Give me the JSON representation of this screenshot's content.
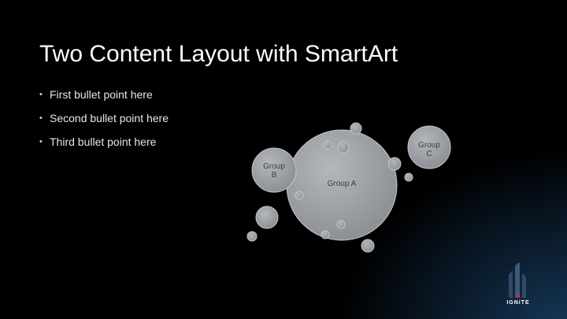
{
  "slide": {
    "title": "Two Content Layout with SmartArt",
    "bullets": [
      "First bullet point here",
      "Second bullet point here",
      "Third bullet point here"
    ]
  },
  "smartart": {
    "groups": [
      {
        "label": "Group A"
      },
      {
        "label_lines": [
          "Group",
          "B"
        ]
      },
      {
        "label_lines": [
          "Group",
          "C"
        ]
      }
    ]
  },
  "logo": {
    "text": "IGNiTE",
    "icon": "ignite-flame-icon"
  },
  "colors": {
    "background": "#000000",
    "title_text": "#ffffff",
    "bullet_text": "#e6e6e6",
    "circle_fill": "#9a9ea3",
    "circle_stroke": "#c4c7ca",
    "accent_glow": "#16395a"
  }
}
